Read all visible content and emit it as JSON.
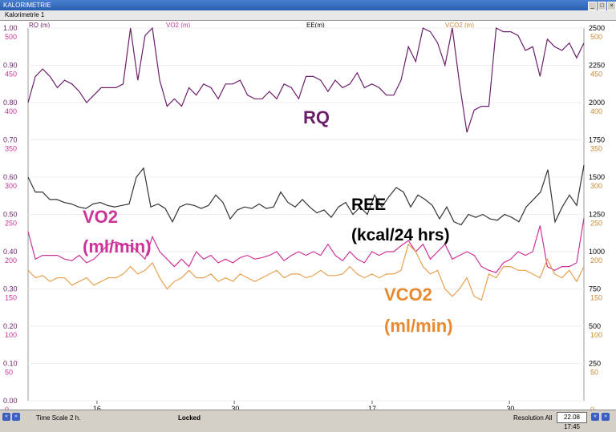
{
  "window": {
    "title": "KALORIMETRIE",
    "menu": "Kalorimetrie 1"
  },
  "status": {
    "time_scale": "Time Scale 2 h.",
    "locked": "Locked",
    "resolution": "Resolution All",
    "time": "22.08 17:45"
  },
  "chart_data": {
    "type": "line",
    "x_ticks": [
      "16",
      ".30",
      "17",
      ".30"
    ],
    "axes": {
      "rq": {
        "label": "RQ (m)",
        "color": "#6b1f6b",
        "range": [
          0.0,
          1.0
        ],
        "ticks": [
          "0.00",
          "0.10",
          "0.20",
          "0.30",
          "0.40",
          "0.50",
          "0.60",
          "0.70",
          "0.80",
          "0.90",
          "1.00"
        ]
      },
      "vo2": {
        "label": "VO2 (m)",
        "color": "#cc3399",
        "range": [
          0,
          500
        ],
        "ticks": [
          "0",
          "50",
          "100",
          "150",
          "200",
          "250",
          "300",
          "350",
          "400",
          "450",
          "500"
        ]
      },
      "ee": {
        "label": "EE(m)",
        "color": "#000000",
        "range": [
          0,
          2500
        ],
        "ticks": [
          "250",
          "500",
          "750",
          "1000",
          "1250",
          "1500",
          "1750",
          "2000",
          "2250",
          "2500"
        ]
      },
      "vco2": {
        "label": "VCO2 (m)",
        "color": "#cc8833",
        "range": [
          0,
          500
        ],
        "ticks": [
          "0",
          "50",
          "100",
          "150",
          "200",
          "250",
          "300",
          "350",
          "400",
          "450",
          "500"
        ]
      }
    },
    "annotations": [
      {
        "text": "RQ",
        "color": "#6b1f6b"
      },
      {
        "text": "REE",
        "color": "#000000"
      },
      {
        "text": "(kcal/24 hrs)",
        "color": "#000000"
      },
      {
        "text": "VO2",
        "color": "#cc3399"
      },
      {
        "text": "(ml/min)",
        "color": "#cc3399"
      },
      {
        "text": "VCO2",
        "color": "#e8892e"
      },
      {
        "text": "(ml/min)",
        "color": "#e8892e"
      }
    ],
    "series": [
      {
        "key": "rq",
        "axis": "rq",
        "color": "#6b1f6b",
        "values": [
          0.8,
          0.87,
          0.89,
          0.87,
          0.84,
          0.86,
          0.85,
          0.83,
          0.8,
          0.82,
          0.84,
          0.84,
          0.84,
          0.85,
          1.0,
          0.86,
          0.98,
          1.0,
          0.86,
          0.79,
          0.81,
          0.79,
          0.84,
          0.82,
          0.85,
          0.84,
          0.81,
          0.85,
          0.85,
          0.86,
          0.82,
          0.81,
          0.81,
          0.83,
          0.81,
          0.85,
          0.84,
          0.81,
          0.87,
          0.87,
          0.86,
          0.83,
          0.86,
          0.84,
          0.85,
          0.88,
          0.84,
          0.85,
          0.84,
          0.82,
          0.82,
          0.86,
          0.95,
          0.91,
          1.0,
          0.99,
          0.96,
          0.9,
          1.0,
          0.85,
          0.72,
          0.78,
          0.79,
          0.79,
          1.0,
          0.99,
          0.99,
          0.98,
          0.94,
          0.95,
          0.87,
          0.97,
          0.95,
          0.94,
          0.96,
          0.92,
          0.96
        ]
      },
      {
        "key": "ee",
        "axis": "ee",
        "color": "#333333",
        "values": [
          1500,
          1400,
          1400,
          1350,
          1350,
          1330,
          1320,
          1300,
          1290,
          1320,
          1330,
          1310,
          1300,
          1310,
          1320,
          1500,
          1560,
          1300,
          1320,
          1290,
          1200,
          1300,
          1320,
          1310,
          1290,
          1310,
          1380,
          1330,
          1220,
          1280,
          1300,
          1290,
          1320,
          1290,
          1300,
          1400,
          1330,
          1300,
          1350,
          1300,
          1260,
          1280,
          1230,
          1300,
          1330,
          1250,
          1300,
          1250,
          1380,
          1300,
          1370,
          1430,
          1400,
          1300,
          1380,
          1350,
          1310,
          1220,
          1300,
          1200,
          1180,
          1250,
          1230,
          1250,
          1220,
          1210,
          1250,
          1230,
          1200,
          1300,
          1350,
          1400,
          1550,
          1200,
          1300,
          1380,
          1310,
          1580
        ]
      },
      {
        "key": "vo2",
        "axis": "vo2",
        "color": "#cc3399",
        "values": [
          227,
          190,
          195,
          195,
          195,
          190,
          188,
          195,
          185,
          190,
          200,
          210,
          213,
          210,
          208,
          200,
          190,
          220,
          200,
          190,
          180,
          190,
          180,
          200,
          190,
          195,
          185,
          190,
          185,
          192,
          195,
          190,
          192,
          195,
          200,
          188,
          195,
          200,
          195,
          200,
          195,
          210,
          195,
          188,
          200,
          190,
          185,
          200,
          195,
          200,
          200,
          208,
          215,
          200,
          210,
          190,
          200,
          210,
          190,
          195,
          200,
          195,
          180,
          175,
          172,
          185,
          190,
          200,
          195,
          200,
          235,
          180,
          175,
          180,
          180,
          185,
          245
        ]
      },
      {
        "key": "vco2",
        "axis": "vco2",
        "color": "#e8a050",
        "values": [
          175,
          165,
          168,
          160,
          165,
          165,
          155,
          160,
          165,
          155,
          160,
          165,
          165,
          170,
          180,
          170,
          175,
          185,
          165,
          150,
          160,
          165,
          175,
          165,
          165,
          170,
          160,
          165,
          160,
          170,
          165,
          160,
          165,
          170,
          175,
          165,
          170,
          170,
          165,
          168,
          175,
          168,
          168,
          170,
          180,
          170,
          165,
          170,
          165,
          170,
          170,
          175,
          210,
          200,
          180,
          170,
          175,
          150,
          140,
          150,
          165,
          140,
          135,
          170,
          165,
          180,
          180,
          175,
          175,
          170,
          165,
          190,
          170,
          165,
          175,
          160,
          180
        ]
      }
    ]
  }
}
